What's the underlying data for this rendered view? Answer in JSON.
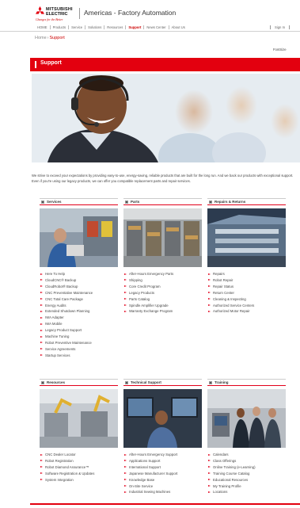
{
  "header": {
    "brand_line1": "MITSUBISHI",
    "brand_line2": "ELECTRIC",
    "tagline": "Changes for the Better",
    "site_title": "Americas - Factory Automation"
  },
  "nav": {
    "items": [
      {
        "label": "HOME"
      },
      {
        "label": "Products"
      },
      {
        "label": "Service"
      },
      {
        "label": "Solutions"
      },
      {
        "label": "Resources"
      },
      {
        "label": "Support",
        "active": true
      },
      {
        "label": "News Center"
      },
      {
        "label": "About Us"
      }
    ],
    "signin": "Sign In"
  },
  "breadcrumb": {
    "home": "Home",
    "separator": "›",
    "current": "Support"
  },
  "font_size_label": "FontSize",
  "page_title": "Support",
  "intro": "We strive to exceed your expectations by providing easy-to-use, energy-saving, reliable products that are built for the long run. And we back our products with exceptional support. Even if you're using our legacy products, we can offer you compatible replacement parts and repair services.",
  "sections": [
    {
      "title": "Services",
      "links": [
        "Here To Help",
        "CloudCNC® Backup",
        "CloudRobot® Backup",
        "CNC Preventative Maintenance",
        "CNC Total Care Package",
        "Energy Audits",
        "Extended Shutdown Planning",
        "IWA Adapter",
        "IWA Mobile",
        "Legacy Product Support",
        "Machine Tuning",
        "Robot Preventive Maintenance",
        "Service Agreements",
        "Startup Services"
      ]
    },
    {
      "title": "Parts",
      "links": [
        "After-Hours Emergency Parts",
        "Shipping",
        "Core Credit Program",
        "Legacy Products",
        "Parts Catalog",
        "Spindle Amplifier Upgrade",
        "Warranty Exchange Program"
      ]
    },
    {
      "title": "Repairs & Returns",
      "links": [
        "Repairs",
        "Robot Repair",
        "Repair Status",
        "Return Center",
        "Cleaning & Inspecting",
        "Authorized Service Centers",
        "Authorized Motor Repair"
      ]
    },
    {
      "title": "Resources",
      "links": [
        "CNC Dealer Locator",
        "Robot Registration",
        "Robot Diamond Assurance™",
        "Software Registration & Updates",
        "System Integration"
      ]
    },
    {
      "title": "Technical Support",
      "links": [
        "After-Hours Emergency Support",
        "Applications Support",
        "International Support",
        "Japanese Manufacturer Support",
        "Knowledge Base",
        "On-Site Service",
        "Industrial Sewing Machines"
      ]
    },
    {
      "title": "Training",
      "links": [
        "Calendars",
        "Class Offerings",
        "Online Training (e-Learning)",
        "Training Course Catalog",
        "Educational Resources",
        "My Training Profile",
        "Locations"
      ]
    }
  ],
  "colors": {
    "accent": "#e3000f",
    "text": "#444444"
  }
}
